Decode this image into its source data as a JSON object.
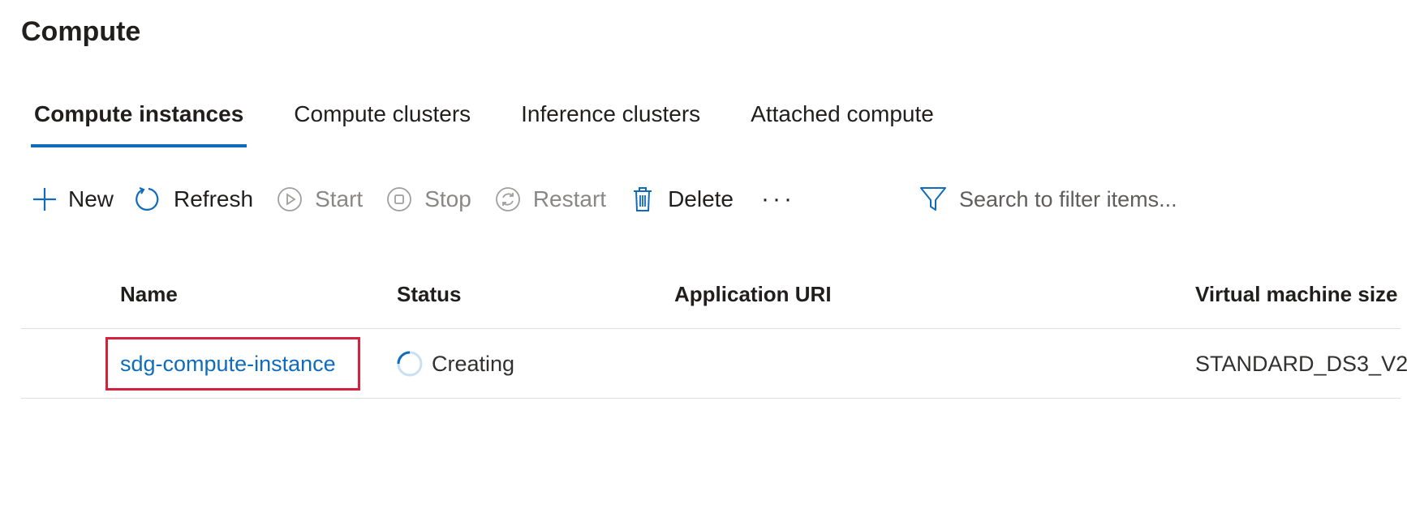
{
  "page": {
    "title": "Compute"
  },
  "tabs": [
    {
      "label": "Compute instances",
      "active": true
    },
    {
      "label": "Compute clusters",
      "active": false
    },
    {
      "label": "Inference clusters",
      "active": false
    },
    {
      "label": "Attached compute",
      "active": false
    }
  ],
  "toolbar": {
    "new_label": "New",
    "refresh_label": "Refresh",
    "start_label": "Start",
    "stop_label": "Stop",
    "restart_label": "Restart",
    "delete_label": "Delete",
    "more_label": "···"
  },
  "search": {
    "placeholder": "Search to filter items..."
  },
  "table": {
    "columns": [
      "Name",
      "Status",
      "Application URI",
      "Virtual machine size"
    ],
    "rows": [
      {
        "name": "sdg-compute-instance",
        "status": "Creating",
        "application_uri": "",
        "vm_size": "STANDARD_DS3_V2"
      }
    ]
  },
  "colors": {
    "accent": "#0f6cbd",
    "highlight_border": "#d4213d",
    "disabled_text": "#8a8886"
  },
  "icons": {
    "new": "plus-icon",
    "refresh": "refresh-icon",
    "start": "play-circle-icon",
    "stop": "stop-circle-icon",
    "restart": "restart-icon",
    "delete": "trash-icon",
    "filter": "filter-icon",
    "status": "spinner-icon"
  }
}
